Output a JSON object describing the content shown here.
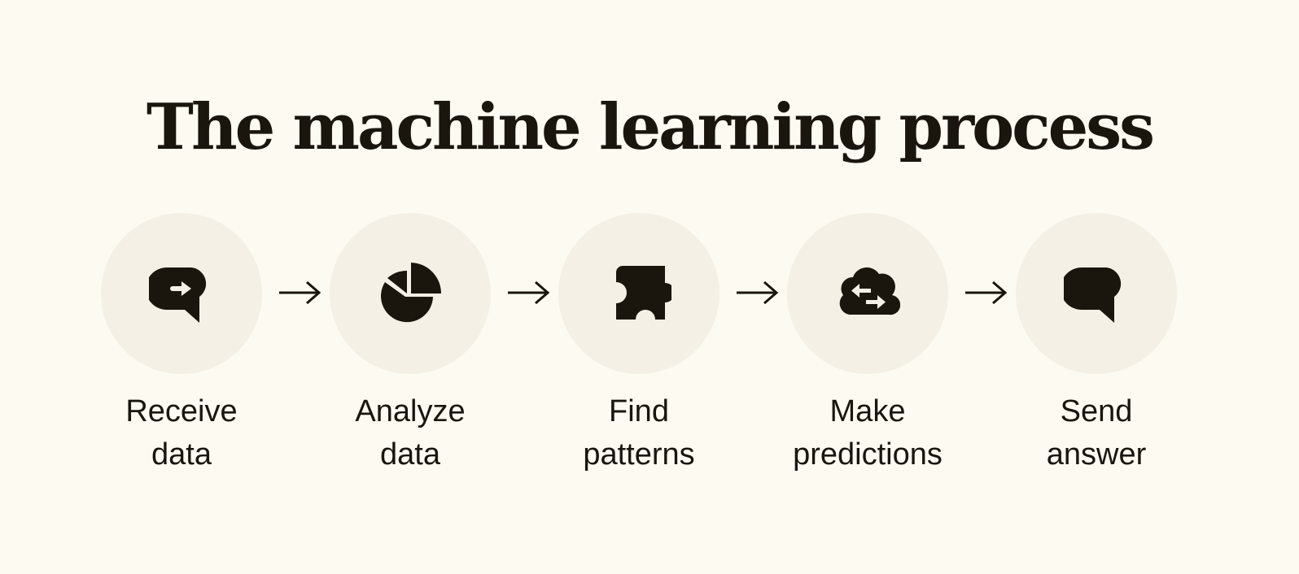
{
  "title": "The machine learning process",
  "colors": {
    "background": "#fdfaf1",
    "circle": "#f4f0e5",
    "ink": "#1a160e"
  },
  "steps": [
    {
      "icon": "speech-bubble-arrow-icon",
      "line1": "Receive",
      "line2": "data"
    },
    {
      "icon": "pie-chart-icon",
      "line1": "Analyze",
      "line2": "data"
    },
    {
      "icon": "puzzle-piece-icon",
      "line1": "Find",
      "line2": "patterns"
    },
    {
      "icon": "cloud-sync-icon",
      "line1": "Make",
      "line2": "predictions"
    },
    {
      "icon": "speech-bubble-icon",
      "line1": "Send",
      "line2": "answer"
    }
  ],
  "connector_icon": "arrow-right-icon"
}
